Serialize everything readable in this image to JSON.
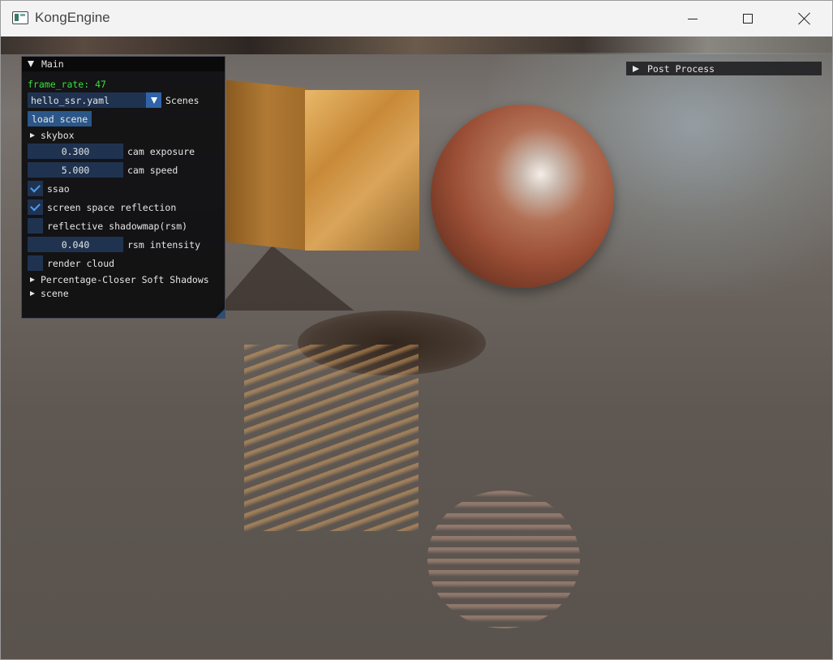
{
  "window": {
    "title": "KongEngine",
    "minimize_icon": "minimize-icon",
    "maximize_icon": "maximize-icon",
    "close_icon": "close-icon"
  },
  "main_panel": {
    "title": "Main",
    "frame_rate_label": "frame_rate: 47",
    "scene_select": {
      "value": "hello_ssr.yaml",
      "label": "Scenes"
    },
    "load_scene_button": "load scene",
    "skybox_label": "skybox",
    "cam_exposure": {
      "value": "0.300",
      "label": "cam exposure"
    },
    "cam_speed": {
      "value": "5.000",
      "label": "cam speed"
    },
    "ssao": {
      "checked": true,
      "label": "ssao"
    },
    "ssr": {
      "checked": true,
      "label": "screen space reflection"
    },
    "rsm": {
      "checked": false,
      "label": "reflective shadowmap(rsm)"
    },
    "rsm_intensity": {
      "value": "0.040",
      "label": "rsm intensity"
    },
    "render_cloud": {
      "checked": false,
      "label": "render cloud"
    },
    "pcss_label": "Percentage-Closer Soft Shadows",
    "scene_label": "scene"
  },
  "post_process_panel": {
    "title": "Post Process"
  },
  "colors": {
    "fps_text": "#36e03a",
    "frame_bg": "#1f3350",
    "button": "#2b5688",
    "checkmark": "#4f9cf2"
  }
}
